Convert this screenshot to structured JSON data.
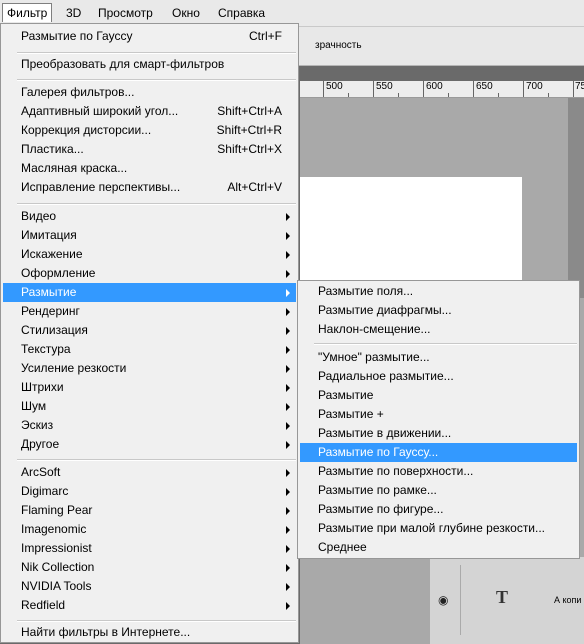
{
  "menubar": {
    "items": [
      "Фильтр",
      "3D",
      "Просмотр",
      "Окно",
      "Справка"
    ]
  },
  "optionsbar": {
    "opacity_label": "зрачность"
  },
  "ruler": {
    "ticks": [
      "500",
      "550",
      "600",
      "650",
      "700",
      "75"
    ]
  },
  "filter_menu": {
    "items": [
      {
        "label": "Размытие по Гауссу",
        "shortcut": "Ctrl+F"
      },
      {
        "label": "Преобразовать для смарт-фильтров"
      },
      {
        "label": "Галерея фильтров..."
      },
      {
        "label": "Адаптивный широкий угол...",
        "shortcut": "Shift+Ctrl+A"
      },
      {
        "label": "Коррекция дисторсии...",
        "shortcut": "Shift+Ctrl+R"
      },
      {
        "label": "Пластика...",
        "shortcut": "Shift+Ctrl+X"
      },
      {
        "label": "Масляная краска..."
      },
      {
        "label": "Исправление перспективы...",
        "shortcut": "Alt+Ctrl+V"
      },
      {
        "label": "Видео"
      },
      {
        "label": "Имитация"
      },
      {
        "label": "Искажение"
      },
      {
        "label": "Оформление"
      },
      {
        "label": "Размытие"
      },
      {
        "label": "Рендеринг"
      },
      {
        "label": "Стилизация"
      },
      {
        "label": "Текстура"
      },
      {
        "label": "Усиление резкости"
      },
      {
        "label": "Штрихи"
      },
      {
        "label": "Шум"
      },
      {
        "label": "Эскиз"
      },
      {
        "label": "Другое"
      },
      {
        "label": "ArcSoft"
      },
      {
        "label": "Digimarc"
      },
      {
        "label": "Flaming Pear"
      },
      {
        "label": "Imagenomic"
      },
      {
        "label": "Impressionist"
      },
      {
        "label": "Nik Collection"
      },
      {
        "label": "NVIDIA Tools"
      },
      {
        "label": "Redfield"
      },
      {
        "label": "Найти фильтры в Интернете..."
      }
    ]
  },
  "blur_submenu": {
    "items": [
      {
        "label": "Размытие поля..."
      },
      {
        "label": "Размытие диафрагмы..."
      },
      {
        "label": "Наклон-смещение..."
      },
      {
        "label": "\"Умное\" размытие..."
      },
      {
        "label": "Радиальное размытие..."
      },
      {
        "label": "Размытие"
      },
      {
        "label": "Размытие +"
      },
      {
        "label": "Размытие в движении..."
      },
      {
        "label": "Размытие по Гауссу..."
      },
      {
        "label": "Размытие по поверхности..."
      },
      {
        "label": "Размытие по рамке..."
      },
      {
        "label": "Размытие по фигуре..."
      },
      {
        "label": "Размытие при малой глубине резкости..."
      },
      {
        "label": "Среднее"
      }
    ]
  },
  "layers": {
    "layer_name": "А копи"
  },
  "colors": {
    "highlight": "#3399ff",
    "menu_bg": "#f0f0f0"
  }
}
